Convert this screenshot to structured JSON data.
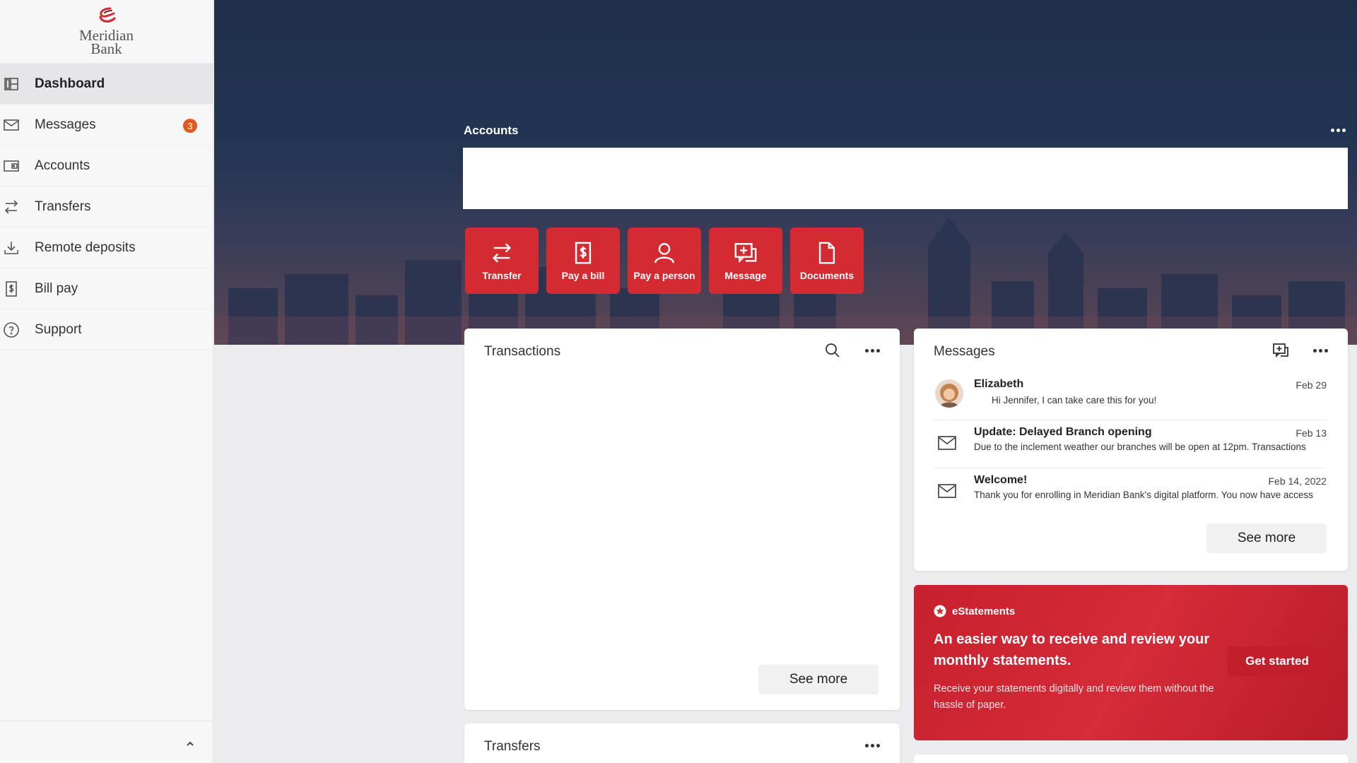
{
  "brand": {
    "name_line1": "Meridian",
    "name_line2": "Bank",
    "accent_color": "#d42b32",
    "logo_icon": "swirl-logo-icon"
  },
  "sidebar": {
    "items": [
      {
        "label": "Dashboard",
        "icon": "dashboard-icon",
        "active": true
      },
      {
        "label": "Messages",
        "icon": "envelope-icon",
        "badge": "3"
      },
      {
        "label": "Accounts",
        "icon": "wallet-icon"
      },
      {
        "label": "Transfers",
        "icon": "transfer-arrows-icon"
      },
      {
        "label": "Remote deposits",
        "icon": "download-icon"
      },
      {
        "label": "Bill pay",
        "icon": "dollar-bill-icon"
      },
      {
        "label": "Support",
        "icon": "help-circle-icon"
      }
    ],
    "collapse_icon": "chevron-up-icon"
  },
  "accounts": {
    "title": "Accounts"
  },
  "quick_actions": [
    {
      "label": "Transfer",
      "icon": "transfer-arrows-icon"
    },
    {
      "label": "Pay a bill",
      "icon": "dollar-bill-icon"
    },
    {
      "label": "Pay a person",
      "icon": "person-icon"
    },
    {
      "label": "Message",
      "icon": "compose-message-icon"
    },
    {
      "label": "Documents",
      "icon": "document-icon"
    }
  ],
  "transactions": {
    "title": "Transactions",
    "see_more": "See more"
  },
  "transfers": {
    "title": "Transfers"
  },
  "messages": {
    "title": "Messages",
    "see_more": "See more",
    "items": [
      {
        "sender": "Elizabeth",
        "date": "Feb 29",
        "preview": "Hi Jennifer, I can take care this for you!",
        "icon": "avatar"
      },
      {
        "sender": "Update: Delayed Branch opening",
        "date": "Feb 13",
        "preview": "Due to the inclement weather our branches will be open at 12pm. Transactions",
        "icon": "envelope-icon"
      },
      {
        "sender": "Welcome!",
        "date": "Feb 14, 2022",
        "preview": "Thank you for enrolling in Meridian Bank's digital platform. You now have access",
        "icon": "envelope-icon"
      }
    ]
  },
  "estatements": {
    "tag": "eStatements",
    "headline": "An easier way to receive and review your monthly statements.",
    "body": "Receive your statements digitally and review them without the hassle of paper.",
    "button": "Get started"
  }
}
